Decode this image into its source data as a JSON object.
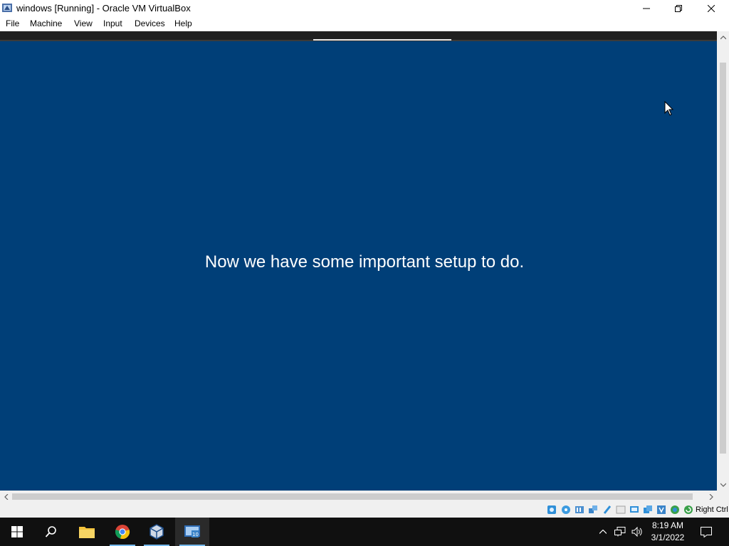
{
  "window": {
    "title": "windows [Running] - Oracle VM VirtualBox",
    "icon": "virtualbox-app-icon",
    "controls": [
      "minimize-icon",
      "restore-icon",
      "close-icon"
    ]
  },
  "menubar": {
    "items": [
      "File",
      "Machine",
      "View",
      "Input",
      "Devices",
      "Help"
    ]
  },
  "guest": {
    "message": "Now we have some important setup to do.",
    "background_color": "#003f78"
  },
  "statusbar": {
    "icons": [
      "hard-disk-icon",
      "optical-drive-icon",
      "audio-icon",
      "network-icon",
      "usb-icon",
      "shared-folders-icon",
      "display-icon",
      "recording-icon",
      "cpu-icon",
      "mouse-integration-icon",
      "keyboard-icon"
    ],
    "host_key": "Right Ctrl"
  },
  "taskbar": {
    "items": [
      "start-icon",
      "search-icon",
      "file-explorer-icon",
      "chrome-icon",
      "virtualbox-icon",
      "virtualbox-vm-icon"
    ],
    "tray_icons": [
      "show-hidden-icons-icon",
      "network-tray-icon",
      "volume-icon",
      "notifications-icon"
    ],
    "time": "8:19 AM",
    "date": "3/1/2022",
    "accent_color": "#76b9ed"
  }
}
